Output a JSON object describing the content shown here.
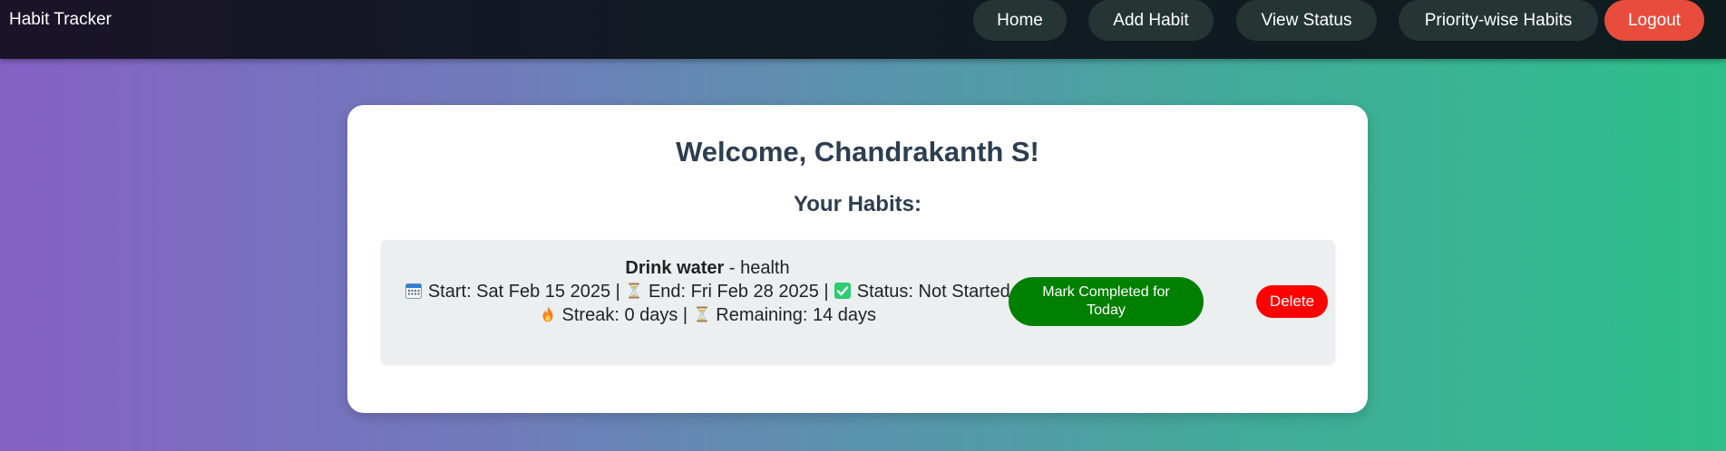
{
  "navbar": {
    "brand": "Habit Tracker",
    "links": {
      "home": "Home",
      "add_habit": "Add Habit",
      "view_status": "View Status",
      "priority": "Priority-wise Habits",
      "logout": "Logout"
    }
  },
  "main": {
    "welcome": "Welcome, Chandrakanth S!",
    "subtitle": "Your Habits:",
    "habits": [
      {
        "name": "Drink water",
        "separator": " - ",
        "category": "health",
        "start_label": "Start: Sat Feb 15 2025 |",
        "end_label": "End: Fri Feb 28 2025 |",
        "status_label": "Status: Not Started",
        "streak_label": "Streak: 0 days |",
        "remaining_label": "Remaining: 14 days",
        "mark_button": "Mark Completed for Today",
        "delete_button": "Delete"
      }
    ]
  },
  "colors": {
    "logout": "#e74c3c",
    "mark_button": "#008000",
    "delete_button": "#ff0000",
    "heading": "#2c3e50"
  },
  "icons": {
    "calendar": "calendar-icon",
    "hourglass": "hourglass-icon",
    "check": "check-icon",
    "fire": "fire-icon"
  }
}
